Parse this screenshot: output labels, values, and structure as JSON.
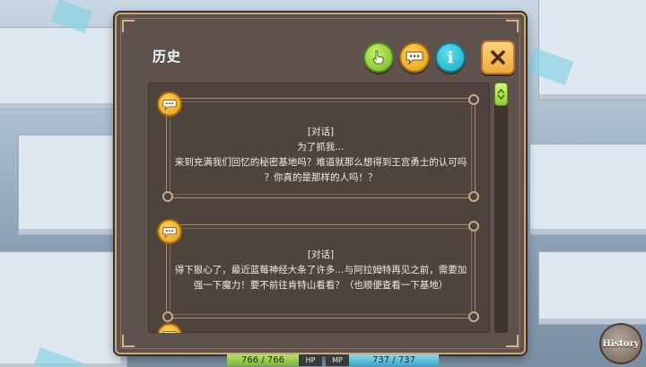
{
  "dialog": {
    "title": "历史",
    "buttons": {
      "skip_icon": "hand-pointer-icon",
      "log_icon": "speech-bubble-icon",
      "info_label": "i",
      "close_icon": "close-icon"
    }
  },
  "log": {
    "entries": [
      {
        "icon": "speech-bubble-icon",
        "lines": [
          "[对话]",
          "为了抓我…",
          "来到充满我们回忆的秘密基地吗？难道就那么想得到王宫勇士的认可吗",
          "？你真的是那样的人吗！？"
        ]
      },
      {
        "icon": "speech-bubble-icon",
        "lines": [
          "[对话]",
          "得下狠心了，最近蓝莓神经大条了许多…与阿拉姆特再见之前，需要加",
          "强一下魔力！要不前往肯特山看看？（也顺便查看一下基地）"
        ]
      },
      {
        "icon": "speech-bubble-icon",
        "lines": []
      }
    ]
  },
  "hud": {
    "hp_value": "766 / 766",
    "hp_label": "HP",
    "mp_label": "MP",
    "mp_value": "737 / 737"
  },
  "history_button": {
    "label": "History"
  },
  "colors": {
    "panel": "#5f514b",
    "frame": "#c9a77a",
    "accent_green": "#8ccf30",
    "accent_orange": "#f0a93a"
  }
}
